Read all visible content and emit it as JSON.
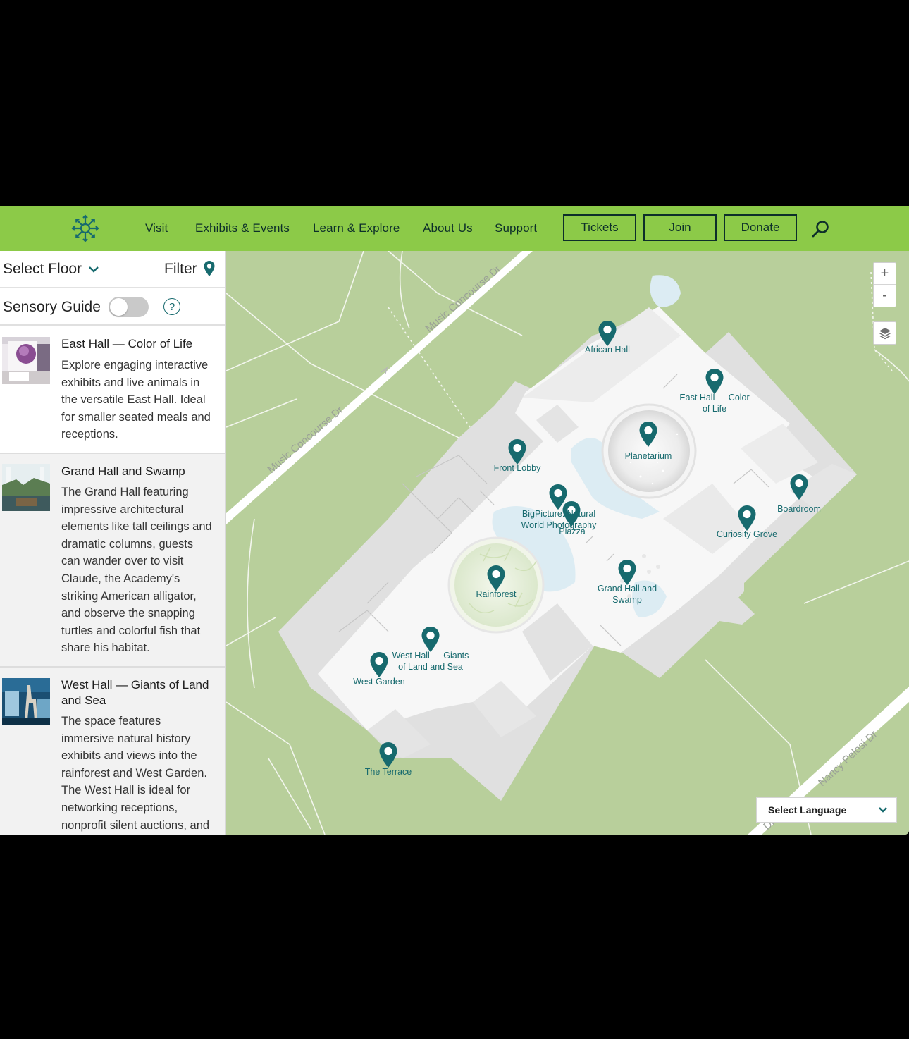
{
  "header": {
    "nav": [
      "Visit",
      "Exhibits & Events",
      "Learn & Explore",
      "About Us",
      "Support"
    ],
    "buttons": {
      "tickets": "Tickets",
      "join": "Join",
      "donate": "Donate"
    }
  },
  "sidebar": {
    "select_floor": "Select Floor",
    "filter": "Filter",
    "sensory_guide": "Sensory Guide",
    "help": "?",
    "cards": [
      {
        "title": "East Hall — Color of Life",
        "desc": [
          "Explore engaging interactive",
          "exhibits and live animals in",
          "the versatile East Hall. Ideal",
          "for smaller seated meals and",
          "receptions."
        ]
      },
      {
        "title": "Grand Hall and Swamp",
        "desc": [
          "The Grand Hall featuring",
          "impressive architectural",
          "elements like tall ceilings and",
          "dramatic columns, guests",
          "can wander over to visit",
          "Claude, the Academy's",
          "striking American alligator,",
          "and observe the snapping",
          "turtles and colorful fish that",
          "share his habitat."
        ]
      },
      {
        "title_lines": [
          "West Hall — Giants of Land",
          "and Sea"
        ],
        "desc": [
          "The space features",
          "immersive natural history",
          "exhibits and views into the",
          "rainforest and West Garden.",
          "The West Hall is ideal for",
          "networking receptions,",
          "nonprofit silent auctions, and"
        ]
      }
    ]
  },
  "map": {
    "zoom_in": "+",
    "zoom_out": "-",
    "streets": [
      "Music Concourse Dr",
      "Music Concourse Dr",
      "Nancy Pelosi Dr",
      "Dr"
    ],
    "locations": [
      {
        "lines": [
          "African Hall"
        ]
      },
      {
        "lines": [
          "East Hall — Color",
          "of Life"
        ]
      },
      {
        "lines": [
          "Planetarium"
        ]
      },
      {
        "lines": [
          "Front Lobby"
        ]
      },
      {
        "lines": [
          "BigPicture: Natural",
          "World Photography"
        ]
      },
      {
        "lines": [
          "Piazza"
        ]
      },
      {
        "lines": [
          "Boardroom"
        ]
      },
      {
        "lines": [
          "Curiosity Grove"
        ]
      },
      {
        "lines": [
          "Rainforest"
        ]
      },
      {
        "lines": [
          "Grand Hall and",
          "Swamp"
        ]
      },
      {
        "lines": [
          "West Hall — Giants",
          "of Land and Sea"
        ]
      },
      {
        "lines": [
          "West Garden"
        ]
      },
      {
        "lines": [
          "The Terrace"
        ]
      }
    ],
    "language": "Select Language"
  },
  "colors": {
    "header_green": "#8cca48",
    "pin_teal": "#176a6e",
    "map_green": "#b8cf9b",
    "building": "#f5f5f5"
  }
}
